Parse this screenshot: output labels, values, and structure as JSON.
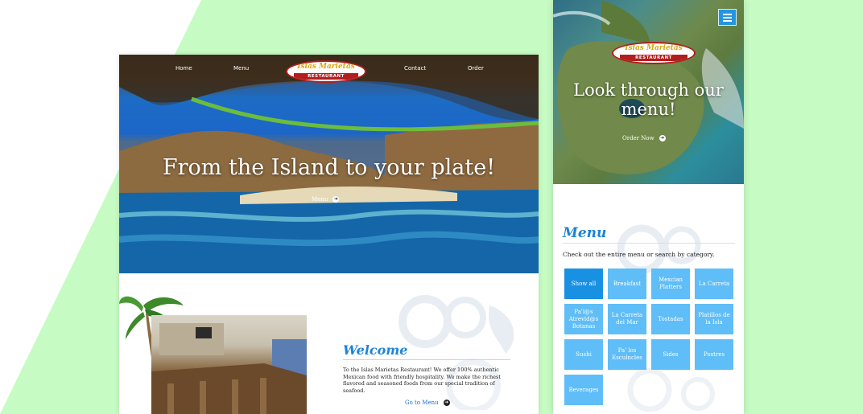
{
  "colors": {
    "page_accent_green": "#c6fcc4",
    "brand_blue": "#1d84d6",
    "category_tile": "#5fbdf7",
    "category_tile_active": "#1891e3",
    "logo_red": "#b21e1e",
    "logo_gold": "#d7a80d"
  },
  "desktop": {
    "nav": {
      "home": "Home",
      "menu": "Menu",
      "contact": "Contact",
      "order": "Order"
    },
    "logo": {
      "line1": "Islas Marietas",
      "line2": "RESTAURANT"
    },
    "hero_title": "From the Island to your plate!",
    "hero_cta": "Menu",
    "welcome": {
      "title": "Welcome",
      "text": "To the Islas Marietas Restaurant! We offer 100% authentic Mexican food with friendly hospitality. We make the richest flavored and seasoned foods from our special tradition of seafood.",
      "cta": "Go to Menu"
    }
  },
  "mobile": {
    "logo": {
      "line1": "Islas Marietas",
      "line2": "RESTAURANT"
    },
    "hero_title": "Look through our menu!",
    "hero_cta": "Order Now",
    "menu": {
      "title": "Menu",
      "subtitle": "Check out the entire menu or search by category.",
      "categories": [
        "Show all",
        "Breakfast",
        "Mexcian Platters",
        "La Carreta",
        "Pa'l@s Atrevid@s Botanas",
        "La Carreta del Mar",
        "Tostadas",
        "Platillos de la Isla",
        "Sushi",
        "Pa' los Esculncles",
        "Sides",
        "Postres",
        "Beverages"
      ]
    }
  }
}
